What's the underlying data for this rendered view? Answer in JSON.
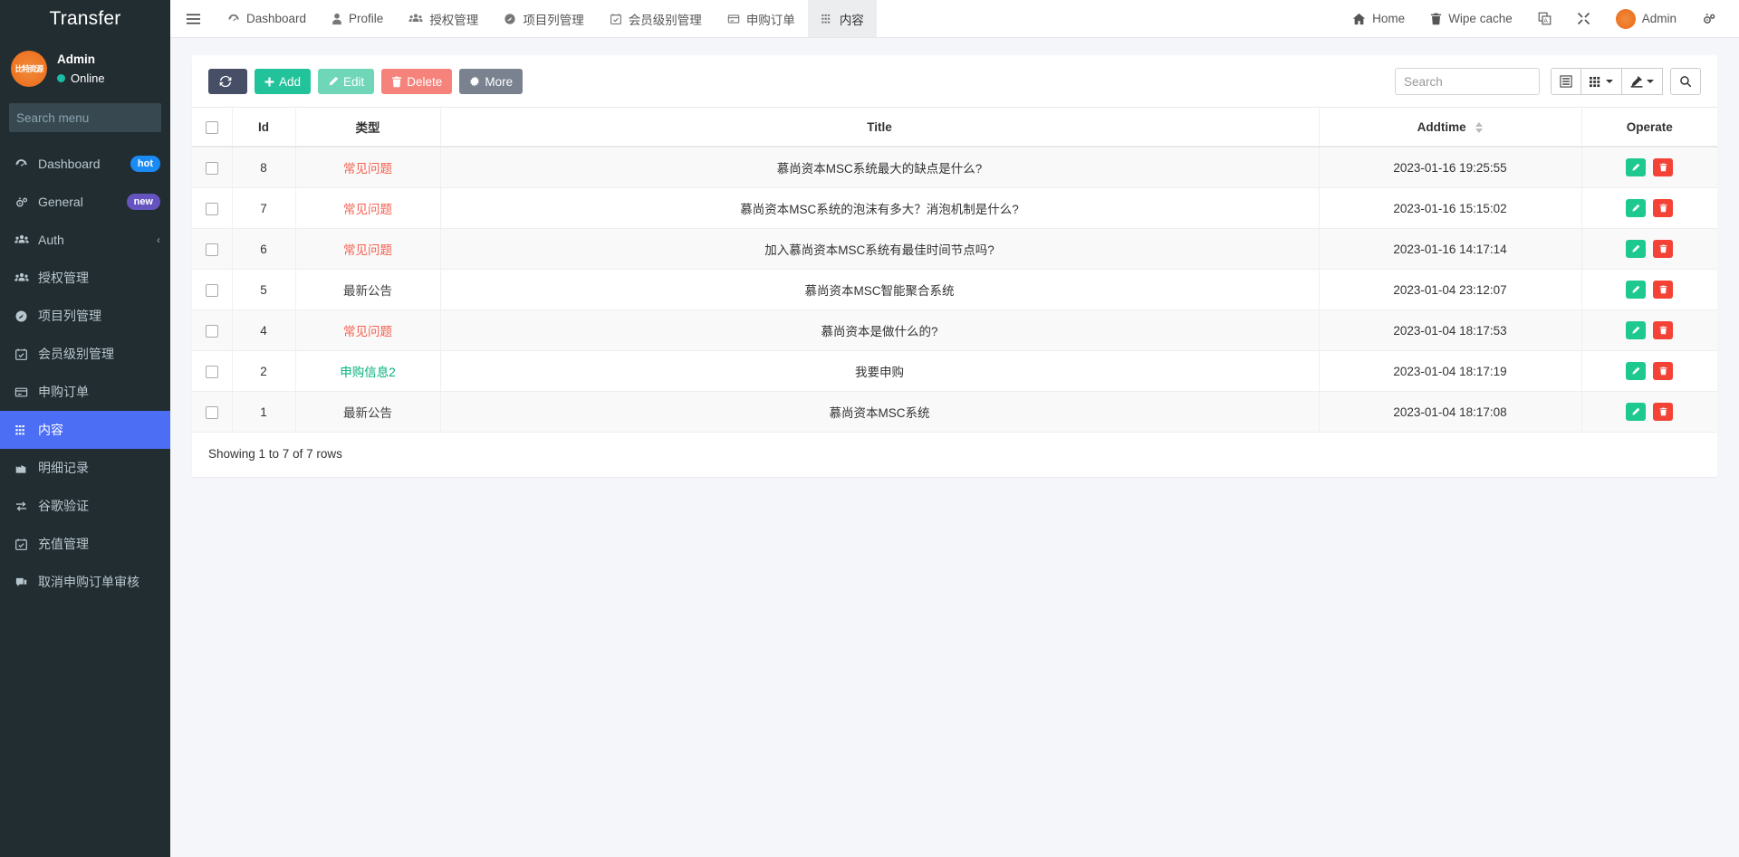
{
  "sidebar": {
    "brand": "Transfer",
    "user": {
      "name": "Admin",
      "status": "Online",
      "avatar_text": "比特资源"
    },
    "search": {
      "placeholder": "Search menu",
      "value": "",
      "icon": "search-icon"
    },
    "items": [
      {
        "label": "Dashboard",
        "icon": "dashboard-icon",
        "badge": "hot",
        "badge_type": "hot"
      },
      {
        "label": "General",
        "icon": "gears-icon",
        "badge": "new",
        "badge_type": "new"
      },
      {
        "label": "Auth",
        "icon": "users-icon",
        "badge": "",
        "caret": "‹"
      },
      {
        "label": "授权管理",
        "icon": "users-icon",
        "badge": ""
      },
      {
        "label": "项目列管理",
        "icon": "circle-icon",
        "badge": ""
      },
      {
        "label": "会员级别管理",
        "icon": "calendar-check-icon",
        "badge": ""
      },
      {
        "label": "申购订单",
        "icon": "card-icon",
        "badge": ""
      },
      {
        "label": "内容",
        "icon": "grid-dots-icon",
        "badge": "",
        "active": true
      },
      {
        "label": "明细记录",
        "icon": "chart-icon",
        "badge": ""
      },
      {
        "label": "谷歌验证",
        "icon": "exchange-icon",
        "badge": ""
      },
      {
        "label": "充值管理",
        "icon": "calendar-check-icon",
        "badge": ""
      },
      {
        "label": "取消申购订单审核",
        "icon": "comment-icon",
        "badge": ""
      }
    ]
  },
  "topnav": {
    "menu_icon": "hamburger-icon",
    "tabs": [
      {
        "label": "Dashboard",
        "icon": "dashboard-icon",
        "active": false
      },
      {
        "label": "Profile",
        "icon": "user-icon",
        "active": false
      },
      {
        "label": "授权管理",
        "icon": "users-icon",
        "active": false
      },
      {
        "label": "项目列管理",
        "icon": "circle-icon",
        "active": false
      },
      {
        "label": "会员级别管理",
        "icon": "calendar-check-icon",
        "active": false
      },
      {
        "label": "申购订单",
        "icon": "card-icon",
        "active": false
      },
      {
        "label": "内容",
        "icon": "grid-dots-icon",
        "active": true
      }
    ],
    "right": [
      {
        "label": "Home",
        "icon": "home-icon"
      },
      {
        "label": "Wipe cache",
        "icon": "trash-icon"
      },
      {
        "label": "",
        "icon": "translate-icon"
      },
      {
        "label": "",
        "icon": "fullscreen-icon"
      },
      {
        "label": "Admin",
        "icon": "avatar-icon"
      },
      {
        "label": "",
        "icon": "gear-icon"
      }
    ]
  },
  "toolbar": {
    "refresh_label": "",
    "refresh_icon": "refresh-icon",
    "add_label": "Add",
    "edit_label": "Edit",
    "delete_label": "Delete",
    "more_label": "More",
    "search_placeholder": "Search",
    "search_value": "",
    "view_toggle_icon": "list-view-icon",
    "columns_icon": "columns-grid-icon",
    "export_icon": "export-icon",
    "search_button_icon": "search-icon"
  },
  "table": {
    "columns": [
      "",
      "Id",
      "类型",
      "Title",
      "Addtime",
      "Operate"
    ],
    "sort_column": "Addtime",
    "rows": [
      {
        "id": "8",
        "type": "常见问题",
        "type_color": "red",
        "title": "慕尚资本MSC系统最大的缺点是什么?",
        "addtime": "2023-01-16 19:25:55"
      },
      {
        "id": "7",
        "type": "常见问题",
        "type_color": "red",
        "title": "慕尚资本MSC系统的泡沫有多大？消泡机制是什么?",
        "addtime": "2023-01-16 15:15:02"
      },
      {
        "id": "6",
        "type": "常见问题",
        "type_color": "red",
        "title": "加入慕尚资本MSC系统有最佳时间节点吗?",
        "addtime": "2023-01-16 14:17:14"
      },
      {
        "id": "5",
        "type": "最新公告",
        "type_color": "gray",
        "title": "慕尚资本MSC智能聚合系统",
        "addtime": "2023-01-04 23:12:07"
      },
      {
        "id": "4",
        "type": "常见问题",
        "type_color": "red",
        "title": "慕尚资本是做什么的?",
        "addtime": "2023-01-04 18:17:53"
      },
      {
        "id": "2",
        "type": "申购信息2",
        "type_color": "green",
        "title": "我要申购",
        "addtime": "2023-01-04 18:17:19"
      },
      {
        "id": "1",
        "type": "最新公告",
        "type_color": "gray",
        "title": "慕尚资本MSC系统",
        "addtime": "2023-01-04 18:17:08"
      }
    ],
    "row_actions": {
      "edit_icon": "pencil-icon",
      "delete_icon": "trash-icon"
    },
    "footer": "Showing 1 to 7 of 7 rows"
  },
  "colors": {
    "sidebar_bg": "#222d32",
    "accent": "#4c6ef5",
    "add": "#22c39a",
    "delete": "#f5837b",
    "type_red": "#f4604f",
    "type_green": "#00b07a"
  }
}
